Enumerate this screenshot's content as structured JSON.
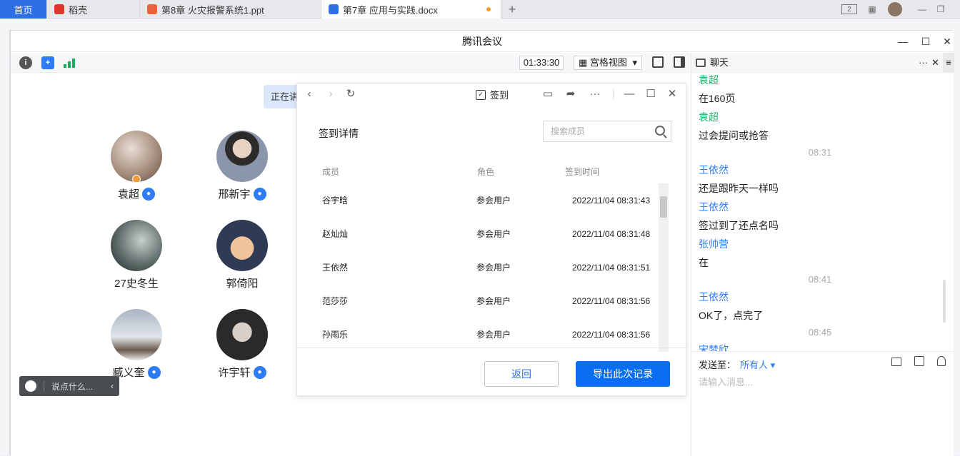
{
  "wps_tabs": {
    "home": "首页",
    "t1": "稻壳",
    "t2": "第8章  火灾报警系统1.ppt",
    "t3": "第7章  应用与实践.docx",
    "new_tab": "+",
    "page_badge": "2"
  },
  "window": {
    "title": "腾讯会议",
    "minimize": "—",
    "maximize": "☐",
    "close": "✕"
  },
  "toolbar": {
    "timer": "01:33:30",
    "view_mode": "宫格视图",
    "dropdown": "▾"
  },
  "speaking_label": "正在讲",
  "participants": [
    {
      "name": "袁超",
      "avatar_color": "#b9a79a",
      "mic": true
    },
    {
      "name": "邢新宇",
      "avatar_color": "#6b7f9c",
      "mic": true
    },
    {
      "name": "27史冬生",
      "avatar_color": "#4d5a58",
      "mic": false
    },
    {
      "name": "郭倚阳",
      "avatar_color": "#2f3a55",
      "mic": false
    },
    {
      "name": "臧义奎",
      "avatar_color": "#b9c3cc",
      "mic": true
    },
    {
      "name": "许宇轩",
      "avatar_color": "#3a3a3a",
      "mic": true
    }
  ],
  "say_something": "说点什么...",
  "checkin": {
    "title": "签到",
    "header": "签到详情",
    "search_placeholder": "搜索成员",
    "columns": {
      "member": "成员",
      "role": "角色",
      "time": "签到时间"
    },
    "rows": [
      {
        "member": "谷宇晗",
        "role": "参会用户",
        "time": "2022/11/04 08:31:43"
      },
      {
        "member": "赵灿灿",
        "role": "参会用户",
        "time": "2022/11/04 08:31:48"
      },
      {
        "member": "王依然",
        "role": "参会用户",
        "time": "2022/11/04 08:31:51"
      },
      {
        "member": "范莎莎",
        "role": "参会用户",
        "time": "2022/11/04 08:31:56"
      },
      {
        "member": "孙雨乐",
        "role": "参会用户",
        "time": "2022/11/04 08:31:56"
      }
    ],
    "back": "返回",
    "export": "导出此次记录"
  },
  "chat": {
    "title": "聊天",
    "more": "···",
    "close": "✕",
    "messages": [
      {
        "type": "sender",
        "text": "袁超",
        "color": "green"
      },
      {
        "type": "msg",
        "text": "在160页"
      },
      {
        "type": "sender",
        "text": "袁超",
        "color": "green"
      },
      {
        "type": "msg",
        "text": "过会提问或抢答"
      },
      {
        "type": "time",
        "text": "08:31"
      },
      {
        "type": "sender",
        "text": "王依然"
      },
      {
        "type": "msg",
        "text": "还是跟昨天一样吗"
      },
      {
        "type": "sender",
        "text": "王依然"
      },
      {
        "type": "msg",
        "text": "签过到了还点名吗"
      },
      {
        "type": "sender",
        "text": "张帅营"
      },
      {
        "type": "msg",
        "text": "在"
      },
      {
        "type": "time",
        "text": "08:41"
      },
      {
        "type": "sender",
        "text": "王依然"
      },
      {
        "type": "msg",
        "text": "OK了，点完了"
      },
      {
        "type": "time",
        "text": "08:45"
      },
      {
        "type": "sender",
        "text": "宋梦欣"
      }
    ],
    "send_to_label": "发送至：",
    "send_to_value": "所有人",
    "input_placeholder": "请输入消息..."
  }
}
